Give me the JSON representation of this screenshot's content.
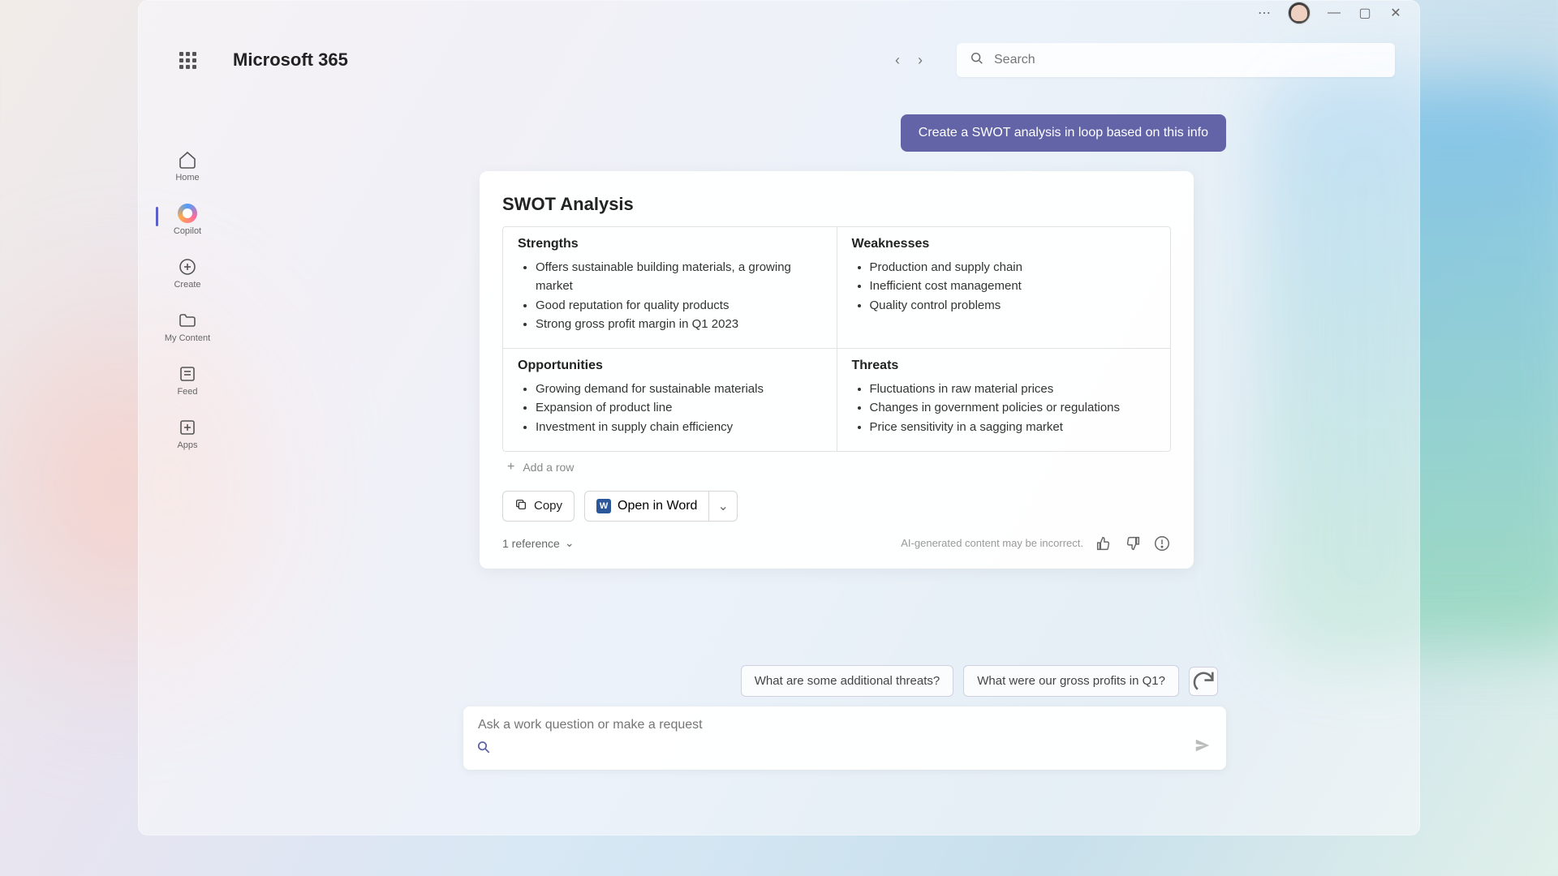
{
  "header": {
    "brand": "Microsoft 365",
    "search_placeholder": "Search"
  },
  "sidebar": {
    "items": [
      {
        "label": "Home"
      },
      {
        "label": "Copilot"
      },
      {
        "label": "Create"
      },
      {
        "label": "My Content"
      },
      {
        "label": "Feed"
      },
      {
        "label": "Apps"
      }
    ]
  },
  "chat": {
    "user_message": "Create a SWOT analysis in loop based on this info",
    "swot": {
      "title": "SWOT Analysis",
      "quadrants": {
        "strengths": {
          "heading": "Strengths",
          "items": [
            "Offers sustainable building materials, a growing market",
            "Good reputation for quality products",
            "Strong gross profit margin in Q1 2023"
          ]
        },
        "weaknesses": {
          "heading": "Weaknesses",
          "items": [
            "Production and supply chain",
            "Inefficient cost management",
            "Quality control problems"
          ]
        },
        "opportunities": {
          "heading": "Opportunities",
          "items": [
            "Growing demand for sustainable materials",
            "Expansion of product line",
            "Investment in supply chain efficiency"
          ]
        },
        "threats": {
          "heading": "Threats",
          "items": [
            "Fluctuations in raw material prices",
            "Changes in government policies or regulations",
            "Price sensitivity in a sagging market"
          ]
        }
      },
      "add_row_label": "Add a row"
    },
    "actions": {
      "copy": "Copy",
      "open_word": "Open in Word"
    },
    "disclaimer": "AI-generated content may be incorrect.",
    "reference_label": "1 reference",
    "suggestions": [
      "What are some additional threats?",
      "What were our gross profits in Q1?"
    ],
    "input_placeholder": "Ask a work question or make a request"
  }
}
